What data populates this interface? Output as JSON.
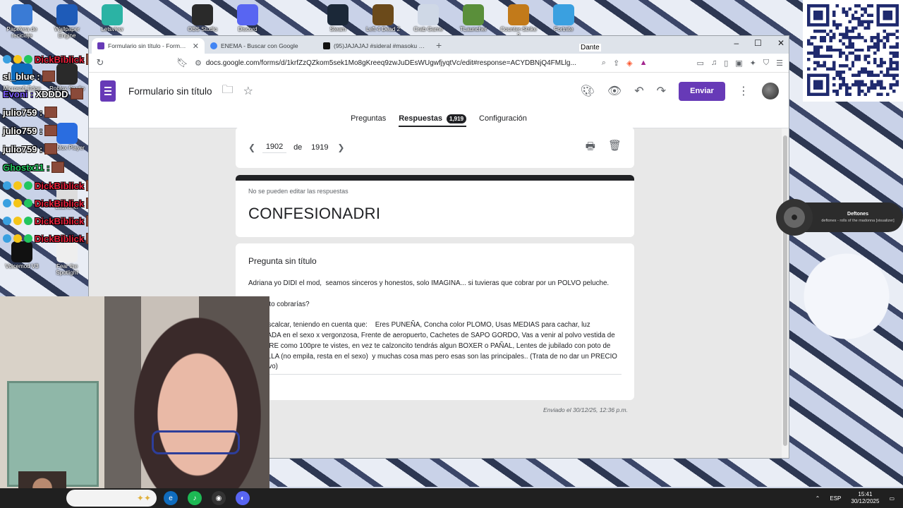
{
  "desktop": {
    "icons": [
      {
        "label": "Papelera de reciclaje",
        "color": "#3a7bd5"
      },
      {
        "label": "Wallpaper Engine",
        "color": "#1e5bb8"
      },
      {
        "label": "Letsview",
        "color": "#2bb3a4"
      },
      {
        "label": "OBS Studio",
        "color": "#2a2a2a"
      },
      {
        "label": "Discord",
        "color": "#5865f2"
      },
      {
        "label": "Steam",
        "color": "#1b2838"
      },
      {
        "label": "Left 4 Dead 2",
        "color": "#6b4a1a"
      },
      {
        "label": "Crab Game",
        "color": "#cfd8e6"
      },
      {
        "label": "TLauncher",
        "color": "#5a8f3a"
      },
      {
        "label": "Counter-Strike 2",
        "color": "#c27a1a"
      },
      {
        "label": "Fortnite",
        "color": "#3aa0e0"
      },
      {
        "label": "Microsoft Edge",
        "color": "#0f6cbd"
      },
      {
        "label": "Roblox Studio",
        "color": "#2a2a2a"
      },
      {
        "label": "Roblox Player",
        "color": "#2a6de0"
      },
      {
        "label": "Launcher",
        "color": "#dddddd"
      },
      {
        "label": "Voicemod V3",
        "color": "#111111"
      },
      {
        "label": "Fear the Spotlight",
        "color": "#eeeeee"
      }
    ]
  },
  "chat": [
    {
      "user": "DickBiblick",
      "color": "#e8213c",
      "msg": ""
    },
    {
      "user": "sl_blue :",
      "color": "#ffffff",
      "msg": ""
    },
    {
      "user": "Evoni :",
      "color": "#7b5cff",
      "msg": "XDDDD"
    },
    {
      "user": "julio759 :",
      "color": "#ffffff",
      "msg": ""
    },
    {
      "user": "julio759 :",
      "color": "#ffffff",
      "msg": ""
    },
    {
      "user": "julio759 :",
      "color": "#ffffff",
      "msg": ""
    },
    {
      "user": "Ghostx11 :",
      "color": "#22c55e",
      "msg": ""
    },
    {
      "user": "DickBiblick",
      "color": "#e8213c",
      "msg": ""
    },
    {
      "user": "DickBiblick",
      "color": "#e8213c",
      "msg": ""
    },
    {
      "user": "DickBiblick",
      "color": "#e8213c",
      "msg": ""
    },
    {
      "user": "DickBiblick",
      "color": "#e8213c",
      "msg": ""
    }
  ],
  "browser": {
    "tabs": [
      {
        "title": "Formulario sin título - Formulario",
        "favicon_color": "#673ab7",
        "active": true
      },
      {
        "title": "ENEMA - Buscar con Google",
        "favicon_color": "#4285f4",
        "active": false
      },
      {
        "title": "(95)JAJAJAJ #sideral #masoku #pa",
        "favicon_color": "#111111",
        "active": false
      }
    ],
    "url": "docs.google.com/forms/d/1krfZzQZkom5sek1Mo8gKreeq9zwJuDEsWUgwfjyqtVc/edit#response=ACYDBNjQ4FMLlg...",
    "profile_overlay": "Dante"
  },
  "forms": {
    "title": "Formulario sin título",
    "send_label": "Enviar",
    "tabs": [
      {
        "label": "Preguntas",
        "active": false
      },
      {
        "label": "Respuestas",
        "active": true,
        "badge": "1,919"
      },
      {
        "label": "Configuración",
        "active": false
      }
    ],
    "nav": {
      "current": "1902",
      "de": "de",
      "total": "1919"
    },
    "no_edit": "No se pueden editar las respuestas",
    "heading": "CONFESIONADRI",
    "question_title": "Pregunta sin título",
    "answer": "Adriana yo DIDI el mod,  seamos sinceros y honestos, solo IMAGINA... si tuvieras que cobrar por un POLVO peluche.\n\n¿Cuanto cobrarías?\n\nSin descalcar, teniendo en cuenta que:    Eres PUNEÑA, Concha color PLOMO, Usas MEDIAS para cachar, luz APAGADA en el sexo x vergonzosa, Frente de aeropuerto, Cachetes de SAPO GORDO, Vas a venir al polvo vestida de HOMBRE como 100pre te vistes, en vez te calzoncito tendrás algun BOXER o PAÑAL, Lentes de jubilado con poto de BOTELLA (no empila, resta en el sexo)  y muchas cosa mas pero esas son las principales.. (Trata de no dar un PRECIO Negativo)",
    "sent": "Enviado el 30/12/25, 12:36 p.m."
  },
  "music": {
    "artist": "Deftones",
    "track": "deftones - rolls of the madonna [visualizer]"
  },
  "taskbar": {
    "lang": "ESP",
    "time": "15:41",
    "date": "30/12/2025"
  }
}
